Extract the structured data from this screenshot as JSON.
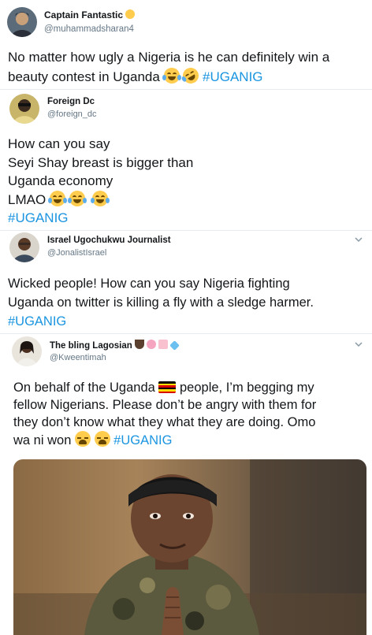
{
  "tweets": [
    {
      "name": "Captain Fantastic",
      "name_suffix_emoji": "relieved-face-icon",
      "handle": "@muhammadsharan4",
      "text_lines": [
        "No matter how ugly a Nigeria is he can definitely win a",
        "beauty contest in Uganda"
      ],
      "hashtag": "#UGANIG"
    },
    {
      "name": "Foreign Dc",
      "handle": "@foreign_dc",
      "text_lines": [
        "How can you say",
        "Seyi Shay breast is bigger than",
        "Uganda economy",
        "LMAO"
      ],
      "hashtag": "#UGANIG"
    },
    {
      "name": "Israel Ugochukwu Journalist",
      "handle": "@JonalistIsrael",
      "text_lines": [
        "Wicked people! How can you say Nigeria fighting",
        "Uganda on twitter is killing a fly with a sledge harmer."
      ],
      "hashtag": "#UGANIG"
    },
    {
      "name": "The bling Lagosian",
      "handle": "@Kweentimah",
      "text_lines": [
        "On behalf of the Uganda",
        "people, I’m begging my",
        "fellow Nigerians. Please don’t be angry with them for",
        "they don’t know what they what they are doing. Omo",
        "wa ni won"
      ],
      "hashtag": "#UGANIG"
    }
  ],
  "colors": {
    "hashtag": "#1b95e0",
    "text": "#14171a",
    "handle": "#657786",
    "divider": "#e6ecf0"
  }
}
